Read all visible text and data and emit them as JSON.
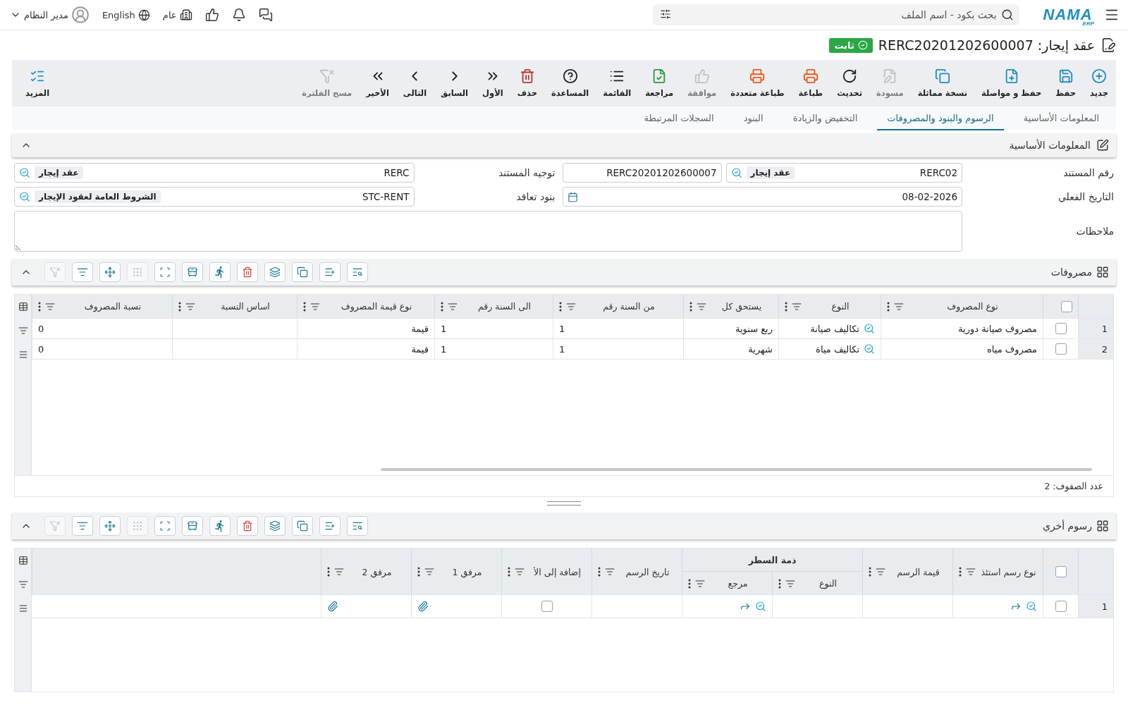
{
  "header": {
    "logo": {
      "name": "NAMA",
      "sub": "ERP"
    },
    "search": {
      "placeholder": "بحث بكود - اسم الملف"
    },
    "branch": "عام",
    "language": "English",
    "user": "مدير النظام"
  },
  "title": {
    "label": "عقد إيجار:",
    "code": "RERC20201202600007",
    "status": "ثابت"
  },
  "toolbar": [
    {
      "label": "جديد",
      "disabled": false
    },
    {
      "label": "حفظ",
      "disabled": false
    },
    {
      "label": "حفظ و مواصلة",
      "disabled": false
    },
    {
      "label": "نسخة مماثلة",
      "disabled": false
    },
    {
      "label": "مسودة",
      "disabled": true
    },
    {
      "label": "تحديث",
      "disabled": false
    },
    {
      "label": "طباعة",
      "disabled": false
    },
    {
      "label": "طباعة متعددة",
      "disabled": false
    },
    {
      "label": "موافقة",
      "disabled": true
    },
    {
      "label": "مراجعة",
      "disabled": false
    },
    {
      "label": "القائمة",
      "disabled": false
    },
    {
      "label": "المساعدة",
      "disabled": false
    },
    {
      "label": "حذف",
      "disabled": false
    },
    {
      "label": "الأول",
      "disabled": false
    },
    {
      "label": "السابق",
      "disabled": false
    },
    {
      "label": "التالى",
      "disabled": false
    },
    {
      "label": "الأخير",
      "disabled": false
    },
    {
      "label": "مسح الفلترة",
      "disabled": true
    }
  ],
  "more": "المزيد",
  "tabs": [
    {
      "label": "المعلومات الأساسية",
      "selected": false
    },
    {
      "label": "الرسوم والبنود والمصروفات",
      "selected": true
    },
    {
      "label": "التخفيض والزيادة",
      "selected": false
    },
    {
      "label": "البنود",
      "selected": false
    },
    {
      "label": "السجلات المرتبطة",
      "selected": false
    }
  ],
  "basic_info": {
    "title": "المعلومات الأساسية",
    "expanded": true,
    "doc_number": {
      "label": "رقم المستند",
      "code": "RERC02",
      "tag": "عقد إيجار",
      "value": "RERC20201202600007"
    },
    "doc_direction": {
      "label": "توجيه المستند",
      "code": "RERC",
      "tag": "عقد إيجار"
    },
    "actual_date": {
      "label": "التاريخ الفعلي",
      "value": "08-02-2026"
    },
    "contract_terms": {
      "label": "بنود تعاقد",
      "code": "STC-RENT",
      "tag": "الشروط العامة لعقود الإيجار"
    },
    "notes": {
      "label": "ملاحظات"
    }
  },
  "expenses": {
    "title": "مصروفات",
    "expanded": true,
    "tools": [
      {
        "disabled": false
      },
      {
        "disabled": false
      },
      {
        "disabled": false
      },
      {
        "disabled": false
      },
      {
        "disabled": false
      },
      {
        "disabled": false
      },
      {
        "disabled": false
      },
      {
        "disabled": false
      },
      {
        "disabled": true
      },
      {
        "disabled": false
      },
      {
        "disabled": false
      },
      {
        "disabled": true
      }
    ],
    "all_selected": false,
    "columns": [
      "نوع المصروف",
      "النوع",
      "يستحق كل",
      "من السنة رقم",
      "الى السنة رقم",
      "نوع قيمة المصروف",
      "اساس النسبة",
      "نسبة المصروف"
    ],
    "rows": [
      {
        "number": "1",
        "selected": false,
        "cells": [
          {
            "kind": "text",
            "text": "مصروف صيانة دورية"
          },
          {
            "kind": "lookup",
            "text": "تكاليف صيانة"
          },
          {
            "kind": "text",
            "text": "ربع سنوية"
          },
          {
            "kind": "number",
            "text": "1"
          },
          {
            "kind": "number",
            "text": "1"
          },
          {
            "kind": "text",
            "text": "قيمة"
          },
          {
            "kind": "empty"
          },
          {
            "kind": "number",
            "text": "0"
          }
        ]
      },
      {
        "number": "2",
        "selected": false,
        "cells": [
          {
            "kind": "text",
            "text": "مصروف مياه"
          },
          {
            "kind": "lookup",
            "text": "تكاليف مياة"
          },
          {
            "kind": "text",
            "text": "شهرية"
          },
          {
            "kind": "number",
            "text": "1"
          },
          {
            "kind": "number",
            "text": "1"
          },
          {
            "kind": "text",
            "text": "قيمة"
          },
          {
            "kind": "empty"
          },
          {
            "kind": "number",
            "text": "0"
          }
        ]
      }
    ],
    "row_count": "عدد الصفوف: 2"
  },
  "other_fees": {
    "title": "رسوم أخري",
    "expanded": true,
    "tools": [
      {
        "disabled": false
      },
      {
        "disabled": false
      },
      {
        "disabled": false
      },
      {
        "disabled": false
      },
      {
        "disabled": false
      },
      {
        "disabled": false
      },
      {
        "disabled": false
      },
      {
        "disabled": false
      },
      {
        "disabled": true
      },
      {
        "disabled": false
      },
      {
        "disabled": false
      },
      {
        "disabled": true
      }
    ],
    "all_selected": false,
    "columns": [
      {
        "label": "نوع رسم استئذ"
      },
      {
        "label": "قيمة الرسم"
      },
      {
        "label": "ذمة السطر",
        "children": [
          {
            "label": "النوع"
          },
          {
            "label": "مرجع"
          }
        ]
      },
      {
        "label": "تاريخ الرسم"
      },
      {
        "label": "إضافة إلى الأ"
      },
      {
        "label": "مرفق 1"
      },
      {
        "label": "مرفق 2"
      }
    ],
    "rows": [
      {
        "number": "1",
        "selected": false,
        "cells": [
          {
            "kind": "lookup"
          },
          {
            "kind": "empty"
          },
          {
            "kind": "empty"
          },
          {
            "kind": "lookup"
          },
          {
            "kind": "empty"
          },
          {
            "kind": "checkbox",
            "checked": false
          },
          {
            "kind": "attachment"
          },
          {
            "kind": "attachment"
          }
        ]
      }
    ]
  }
}
